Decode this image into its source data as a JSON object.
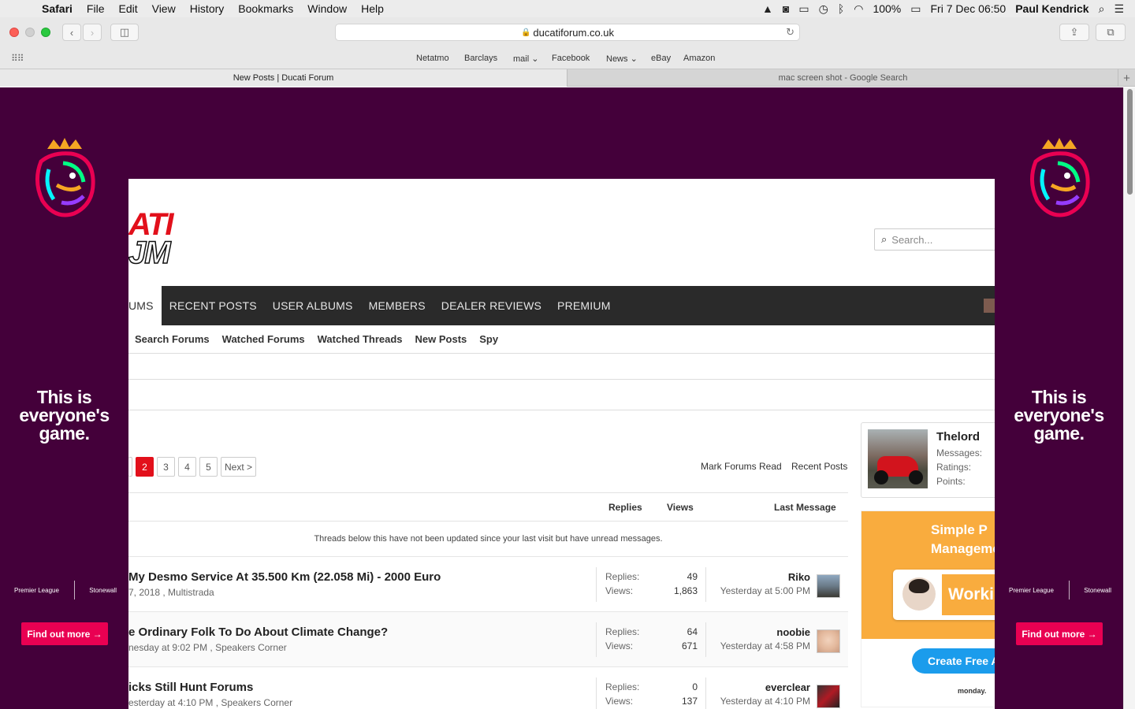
{
  "menubar": {
    "app": "Safari",
    "items": [
      "File",
      "Edit",
      "View",
      "History",
      "Bookmarks",
      "Window",
      "Help"
    ],
    "battery": "100%",
    "datetime": "Fri 7 Dec  06:50",
    "user": "Paul Kendrick"
  },
  "browser": {
    "url": "ducatiforum.co.uk",
    "favorites": [
      "Netatmo",
      "Barclays",
      "mail",
      "Facebook",
      "News",
      "eBay",
      "Amazon"
    ],
    "tabs": [
      {
        "title": "New Posts | Ducati Forum",
        "active": true
      },
      {
        "title": "mac screen shot - Google Search",
        "active": false
      }
    ]
  },
  "ad": {
    "headline": "This is everyone's game.",
    "logo1": "Premier League",
    "logo2": "Stonewall",
    "button": "Find out more →",
    "bg_color": "#44003a",
    "button_color": "#e90052"
  },
  "site": {
    "logo_top": "ATI",
    "logo_bottom": "JM",
    "search_placeholder": "Search...",
    "nav": [
      "UMS",
      "RECENT POSTS",
      "USER ALBUMS",
      "MEMBERS",
      "DEALER REVIEWS",
      "PREMIUM"
    ],
    "subnav": [
      "Search Forums",
      "Watched Forums",
      "Watched Threads",
      "New Posts",
      "Spy"
    ],
    "accent_color": "#e2101b"
  },
  "pagination": {
    "pages": [
      "2",
      "3",
      "4",
      "5"
    ],
    "current": "2",
    "next": "Next >"
  },
  "actions": {
    "mark_read": "Mark Forums Read",
    "recent_posts": "Recent Posts"
  },
  "thread_list": {
    "headers": {
      "replies": "Replies",
      "views": "Views",
      "last": "Last Message"
    },
    "notice": "Threads below this have not been updated since your last visit but have unread messages.",
    "replies_label": "Replies:",
    "views_label": "Views:",
    "threads": [
      {
        "title": "My Desmo Service At 35.500 Km (22.058 Mi) - 2000 Euro",
        "meta": "7, 2018 , Multistrada",
        "replies": "49",
        "views": "1,863",
        "last_user": "Riko",
        "last_time": "Yesterday at 5:00 PM"
      },
      {
        "title": "e Ordinary Folk To Do About Climate Change?",
        "meta": "nesday at 9:02 PM , Speakers Corner",
        "replies": "64",
        "views": "671",
        "last_user": "noobie",
        "last_time": "Yesterday at 4:58 PM"
      },
      {
        "title": "icks Still Hunt Forums",
        "meta": "esterday at 4:10 PM , Speakers Corner",
        "replies": "0",
        "views": "137",
        "last_user": "everclear",
        "last_time": "Yesterday at 4:10 PM"
      }
    ]
  },
  "user_box": {
    "name": "Thelord",
    "stats": [
      "Messages:",
      "Ratings:",
      "Points:"
    ]
  },
  "side_ad": {
    "line1": "Simple P",
    "line2": "Manageme",
    "card_text": "Worki",
    "cta": "Create Free A",
    "brand": "monday."
  }
}
